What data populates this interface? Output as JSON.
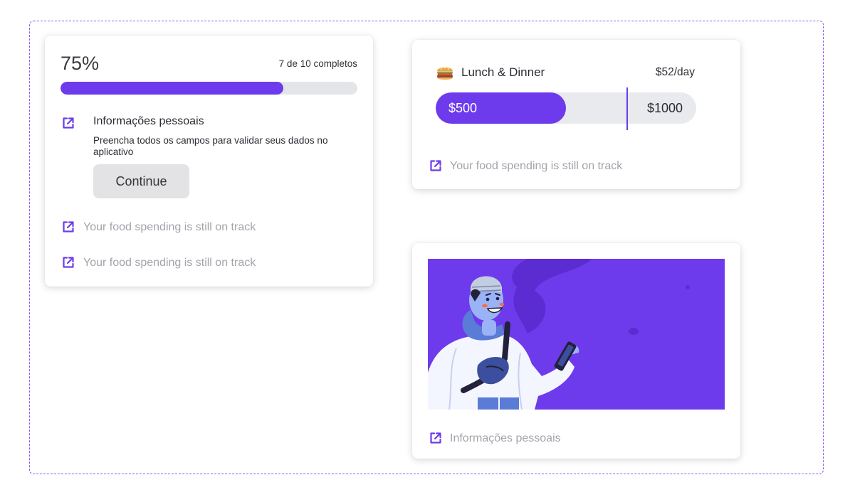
{
  "progress_card": {
    "percent_label": "75%",
    "progress": 0.75,
    "count_label": "7 de 10 completos",
    "step": {
      "title": "Informações pessoais",
      "description": "Preencha todos os campos para validar seus dados no aplicativo",
      "button_label": "Continue"
    },
    "links": [
      {
        "label": "Your food spending is still on track",
        "icon": "external-link-icon"
      },
      {
        "label": "Your food spending is still on track",
        "icon": "external-link-icon"
      }
    ]
  },
  "budget_card": {
    "icon": "burger-icon",
    "title": "Lunch & Dinner",
    "rate": "$52/day",
    "spent_label": "$500",
    "max_label": "$1000",
    "spent_fraction": 0.5,
    "link_label": "Your food spending is still on track"
  },
  "image_card": {
    "illustration": "person-holding-phone-illustration",
    "link_label": "Informações pessoais"
  },
  "colors": {
    "accent": "#6d3bec",
    "track": "#e3e5e8",
    "muted_text": "#a3a3ab",
    "frame_border": "#8f56ef"
  }
}
